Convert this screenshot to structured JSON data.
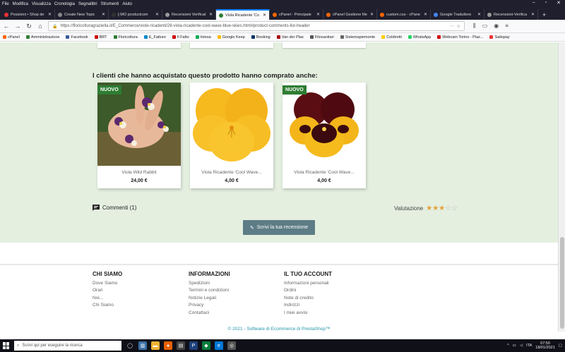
{
  "menubar": [
    "File",
    "Modifica",
    "Visualizza",
    "Cronologia",
    "Segnalibri",
    "Strumenti",
    "Aiuto"
  ],
  "tabs": [
    {
      "label": "Posizioni • Shop de",
      "color": "#e33",
      "active": false
    },
    {
      "label": "Create New Topic",
      "color": "#888",
      "active": false
    },
    {
      "label": "[-MO productcom",
      "color": "#333",
      "active": false
    },
    {
      "label": "Recensioni Verificat",
      "color": "#999",
      "active": false
    },
    {
      "label": "Viola Ricadente 'Co",
      "color": "#2e7d32",
      "active": true
    },
    {
      "label": "cPanel - Principale",
      "color": "#f60",
      "active": false
    },
    {
      "label": "cPanel Gestione file",
      "color": "#f60",
      "active": false
    },
    {
      "label": "custom.css - cPane",
      "color": "#f60",
      "active": false
    },
    {
      "label": "Google Traduttore",
      "color": "#4285f4",
      "active": false
    },
    {
      "label": "Recensioni-Verifica",
      "color": "#999",
      "active": false
    }
  ],
  "url": "https://floricolturagraziella.it/E_Commerce/viole-ricadenti/28-viola-ricadente-cool-wave-blue-skies.html#product-comments-list-header",
  "bookmarks": [
    {
      "label": "cPanel",
      "color": "#f60"
    },
    {
      "label": "Amministrazione",
      "color": "#2e7d32"
    },
    {
      "label": "Facebook",
      "color": "#3b5998"
    },
    {
      "label": "BRT",
      "color": "#c00"
    },
    {
      "label": "Floricoltura",
      "color": "#2e7d32"
    },
    {
      "label": "E_Fatture",
      "color": "#08c"
    },
    {
      "label": "Il Fatto",
      "color": "#c00"
    },
    {
      "label": "Intesa",
      "color": "#0a5"
    },
    {
      "label": "Google Keep",
      "color": "#fb0"
    },
    {
      "label": "Booking",
      "color": "#036"
    },
    {
      "label": "Van der Plas",
      "color": "#a00"
    },
    {
      "label": "Fitosanitari",
      "color": "#555"
    },
    {
      "label": "Sistemapiemonte",
      "color": "#666"
    },
    {
      "label": "Coldiretti",
      "color": "#fc0"
    },
    {
      "label": "WhatsApp",
      "color": "#25d366"
    },
    {
      "label": "Webcam Torino - Piaz...",
      "color": "#c00"
    },
    {
      "label": "Satispay",
      "color": "#e33"
    }
  ],
  "section_title": "I clienti che hanno acquistato questo prodotto hanno comprato anche:",
  "products": [
    {
      "name": "Viola Wild Rabbit",
      "price": "24,00 €",
      "badge": "NUOVO"
    },
    {
      "name": "Viola Ricadente 'Cool Wave...",
      "price": "4,00 €",
      "badge": ""
    },
    {
      "name": "Viola Ricadente 'Cool Wave...",
      "price": "4,00 €",
      "badge": "NUOVO"
    }
  ],
  "comments_label": "Commenti (1)",
  "rating_label": "Valutazione",
  "rating": 3,
  "rating_max": 5,
  "review_button": "Scrivi la tua recensione",
  "footer": {
    "col1": {
      "title": "CHI SIAMO",
      "links": [
        "Dove Siamo",
        "Orari",
        "Noi...",
        "Chi Siamo"
      ]
    },
    "col2": {
      "title": "INFORMAZIONI",
      "links": [
        "Spedizioni",
        "Termini e condizioni",
        "Notizie Legali",
        "Privacy",
        "Contattaci"
      ]
    },
    "col3": {
      "title": "IL TUO ACCOUNT",
      "links": [
        "Informazioni personali",
        "Ordini",
        "Note di credito",
        "Indirizzi",
        "I miei avvisi"
      ]
    },
    "copyright": "© 2021 - Software di Ecommerce di PrestaShop™"
  },
  "taskbar": {
    "search_placeholder": "Scrivi qui per eseguire la ricerca",
    "lang": "ITA",
    "time": "07:50",
    "date": "18/01/2021"
  }
}
